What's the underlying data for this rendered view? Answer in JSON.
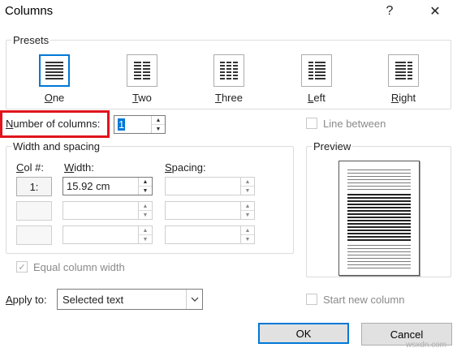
{
  "dialog": {
    "title": "Columns",
    "help_label": "?",
    "close_label": "✕"
  },
  "presets": {
    "label": "Presets",
    "items": [
      {
        "label": "One",
        "underline": "O",
        "rest": "ne",
        "columns": 1,
        "selected": true
      },
      {
        "label": "Two",
        "underline": "T",
        "rest": "wo",
        "columns": 2,
        "selected": false
      },
      {
        "label": "Three",
        "underline": "T",
        "rest": "hree",
        "columns": 3,
        "selected": false
      },
      {
        "label": "Left",
        "underline": "L",
        "rest": "eft",
        "columns": 2,
        "selected": false
      },
      {
        "label": "Right",
        "underline": "R",
        "rest": "ight",
        "columns": 2,
        "selected": false
      }
    ]
  },
  "number_of_columns": {
    "label_u": "N",
    "label_rest": "umber of columns:",
    "value": "1"
  },
  "line_between": {
    "label": "Line between",
    "checked": false,
    "enabled": false
  },
  "width_spacing": {
    "label": "Width and spacing",
    "col_header_u": "C",
    "col_header_rest": "ol #:",
    "width_header_u": "W",
    "width_header_rest": "idth:",
    "spacing_header_u": "S",
    "spacing_header_rest": "pacing:",
    "rows": [
      {
        "col": "1:",
        "width": "15.92 cm",
        "spacing": ""
      },
      {
        "col": "",
        "width": "",
        "spacing": ""
      },
      {
        "col": "",
        "width": "",
        "spacing": ""
      }
    ]
  },
  "equal_column_width": {
    "label": "Equal column width",
    "checked": true,
    "enabled": false
  },
  "preview": {
    "label": "Preview"
  },
  "apply_to": {
    "label_u": "A",
    "label_rest": "pply to:",
    "value": "Selected text"
  },
  "start_new_column": {
    "label": "Start new column",
    "checked": false,
    "enabled": false
  },
  "buttons": {
    "ok": "OK",
    "cancel": "Cancel"
  },
  "watermark": "wsxdn.com",
  "colors": {
    "accent": "#0078d7",
    "highlight": "#e0141c"
  }
}
